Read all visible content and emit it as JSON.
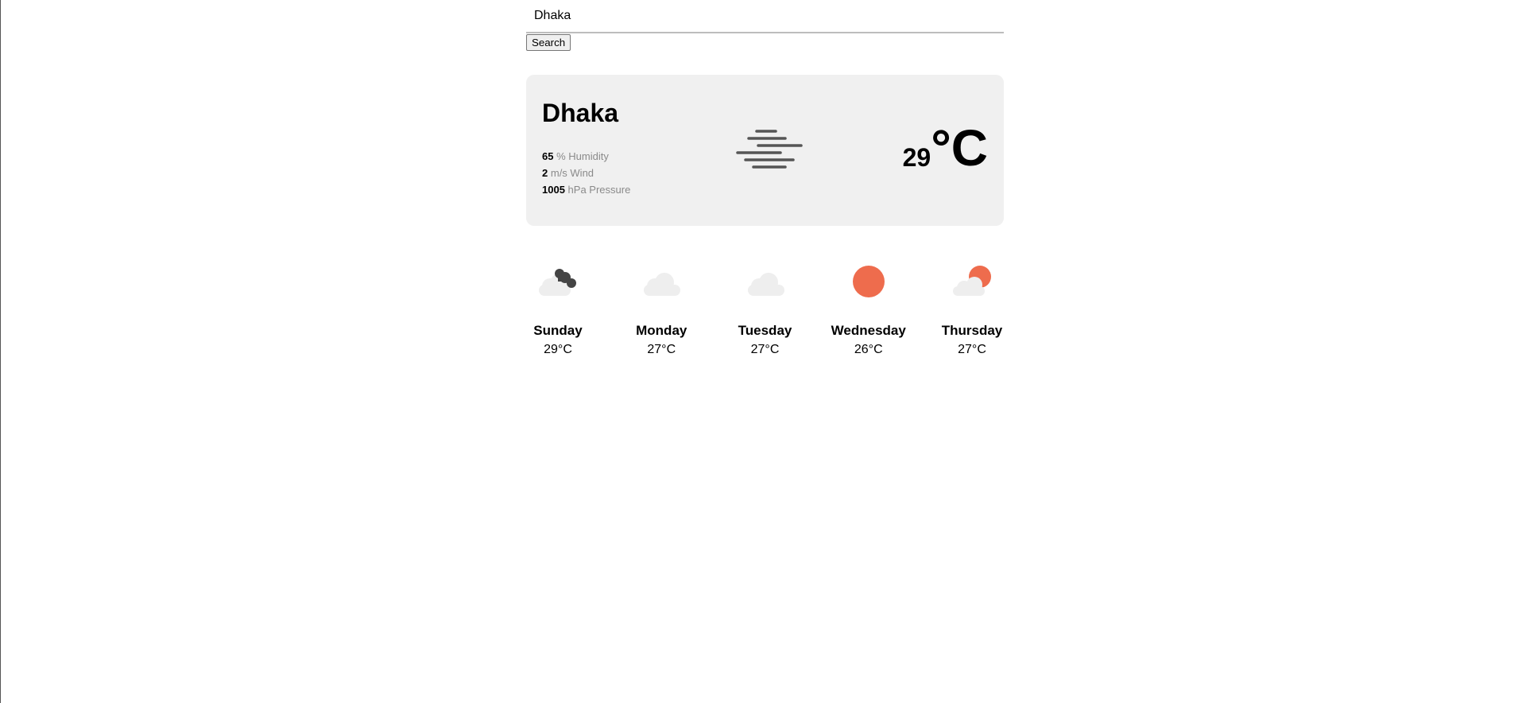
{
  "search": {
    "value": "Dhaka",
    "button_label": "Search"
  },
  "current": {
    "city": "Dhaka",
    "humidity": {
      "value": "65",
      "label": "% Humidity"
    },
    "wind": {
      "value": "2",
      "label": "m/s Wind"
    },
    "pressure": {
      "value": "1005",
      "label": "hPa Pressure"
    },
    "icon": "mist-icon",
    "temperature": "29",
    "unit": "°C"
  },
  "forecast": [
    {
      "day": "Sunday",
      "temp": "29°C",
      "icon": "cloudy-night-icon"
    },
    {
      "day": "Monday",
      "temp": "27°C",
      "icon": "cloud-icon"
    },
    {
      "day": "Tuesday",
      "temp": "27°C",
      "icon": "cloud-icon"
    },
    {
      "day": "Wednesday",
      "temp": "26°C",
      "icon": "sun-icon"
    },
    {
      "day": "Thursday",
      "temp": "27°C",
      "icon": "partly-sunny-icon"
    }
  ],
  "colors": {
    "card_background": "#f0f0f0",
    "sun": "#ee6c4d",
    "cloud": "#eeeeee",
    "dark_cloud": "#444444",
    "muted_text": "#8a8a8a"
  }
}
